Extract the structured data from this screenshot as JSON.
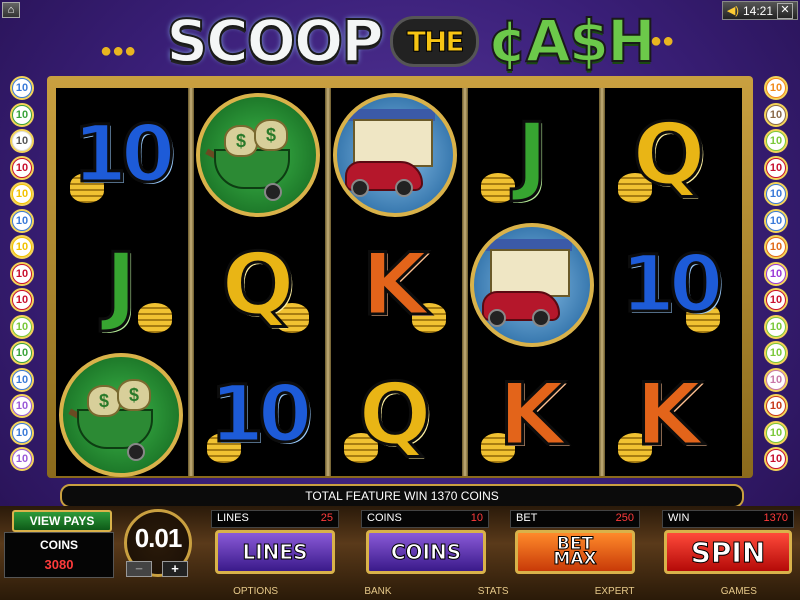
{
  "topbar": {
    "home_icon": "home-icon",
    "time": "14:21",
    "speaker_icon": "speaker-icon",
    "close_icon": "close-icon",
    "close_glyph": "✕",
    "home_glyph": "⌂"
  },
  "title": {
    "word1": "SCOOP",
    "word2": "THE",
    "word3": "¢A$H"
  },
  "reels": [
    [
      "10",
      "J",
      "wheelbarrow"
    ],
    [
      "wheelbarrow",
      "Q",
      "10"
    ],
    [
      "mansion",
      "K",
      "Q"
    ],
    [
      "J",
      "mansion",
      "K"
    ],
    [
      "Q",
      "10",
      "K"
    ]
  ],
  "paylines_left": [
    "10",
    "10",
    "10",
    "10",
    "10",
    "10",
    "10",
    "10",
    "10",
    "10",
    "10",
    "10",
    "10",
    "10",
    "10"
  ],
  "paylines_right": [
    "10",
    "10",
    "10",
    "10",
    "10",
    "10",
    "10",
    "10",
    "10",
    "10",
    "10",
    "10",
    "10",
    "10",
    "10"
  ],
  "payline_colors_left": [
    "#3a7ad8",
    "#39a33a",
    "#e0e0e0",
    "#c8102e",
    "#f2c200",
    "#3a7ad8",
    "#f2c200",
    "#c8102e",
    "#c8102e",
    "#7ac83a",
    "#39a33a",
    "#3a7ad8",
    "#9a5ad8",
    "#3a7ad8",
    "#9a5ad8"
  ],
  "payline_colors_right": [
    "#f28a1a",
    "#8a6a4a",
    "#7ac83a",
    "#c8102e",
    "#3a7ad8",
    "#3a7ad8",
    "#e06a1a",
    "#9a3ad8",
    "#c8102e",
    "#7ac83a",
    "#7ac83a",
    "#c878a8",
    "#c83a1a",
    "#7ac83a",
    "#c8102e"
  ],
  "message": "TOTAL FEATURE WIN 1370 COINS",
  "view_pays": "VIEW PAYS",
  "coins_label": "COINS",
  "coins_value": "3080",
  "coin_size": "0.01",
  "minus_glyph": "−",
  "plus_glyph": "+",
  "lines": {
    "label": "LINES",
    "value": "25"
  },
  "coins": {
    "label": "COINS",
    "value": "10"
  },
  "bet": {
    "label": "BET",
    "value": "250"
  },
  "win": {
    "label": "WIN",
    "value": "1370"
  },
  "buttons": {
    "lines": "LINES",
    "coins": "COINS",
    "betmax_1": "BET",
    "betmax_2": "MAX",
    "spin": "SPIN"
  },
  "menu": [
    "OPTIONS",
    "BANK",
    "STATS",
    "EXPERT",
    "GAMES"
  ],
  "mansion_dollar": "$"
}
